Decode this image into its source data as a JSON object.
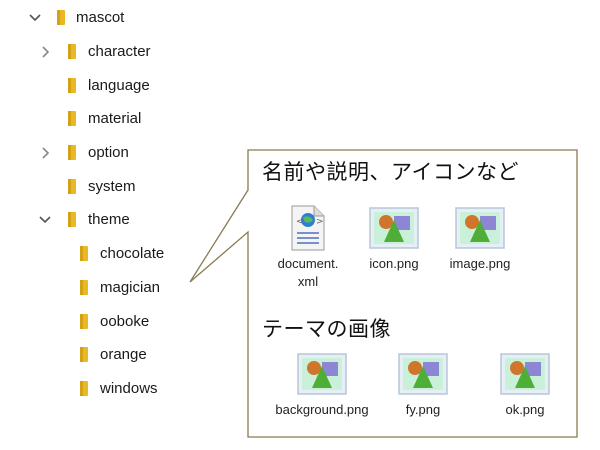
{
  "tree": {
    "root": {
      "label": "mascot",
      "state": "expanded"
    },
    "items": [
      {
        "label": "character",
        "state": "collapsed"
      },
      {
        "label": "language",
        "state": "none"
      },
      {
        "label": "material",
        "state": "none"
      },
      {
        "label": "option",
        "state": "collapsed"
      },
      {
        "label": "system",
        "state": "none"
      },
      {
        "label": "theme",
        "state": "expanded"
      }
    ],
    "theme_children": [
      {
        "label": "chocolate"
      },
      {
        "label": "magician"
      },
      {
        "label": "ooboke"
      },
      {
        "label": "orange"
      },
      {
        "label": "windows"
      }
    ]
  },
  "callout": {
    "section1_title": "名前や説明、アイコンなど",
    "section1_files": [
      {
        "name_line1": "document.",
        "name_line2": "xml",
        "icon": "xml-document-icon"
      },
      {
        "name_line1": "icon.png",
        "name_line2": "",
        "icon": "png-image-icon"
      },
      {
        "name_line1": "image.png",
        "name_line2": "",
        "icon": "png-image-icon"
      }
    ],
    "section2_title": "テーマの画像",
    "section2_files": [
      {
        "name_line1": "background.png",
        "icon": "png-image-icon"
      },
      {
        "name_line1": "fy.png",
        "icon": "png-image-icon"
      },
      {
        "name_line1": "ok.png",
        "icon": "png-image-icon"
      }
    ]
  },
  "colors": {
    "folder": "#e8b923",
    "folder_dark": "#d4a017",
    "callout_border": "#8a7a55",
    "chevron": "#555555"
  }
}
